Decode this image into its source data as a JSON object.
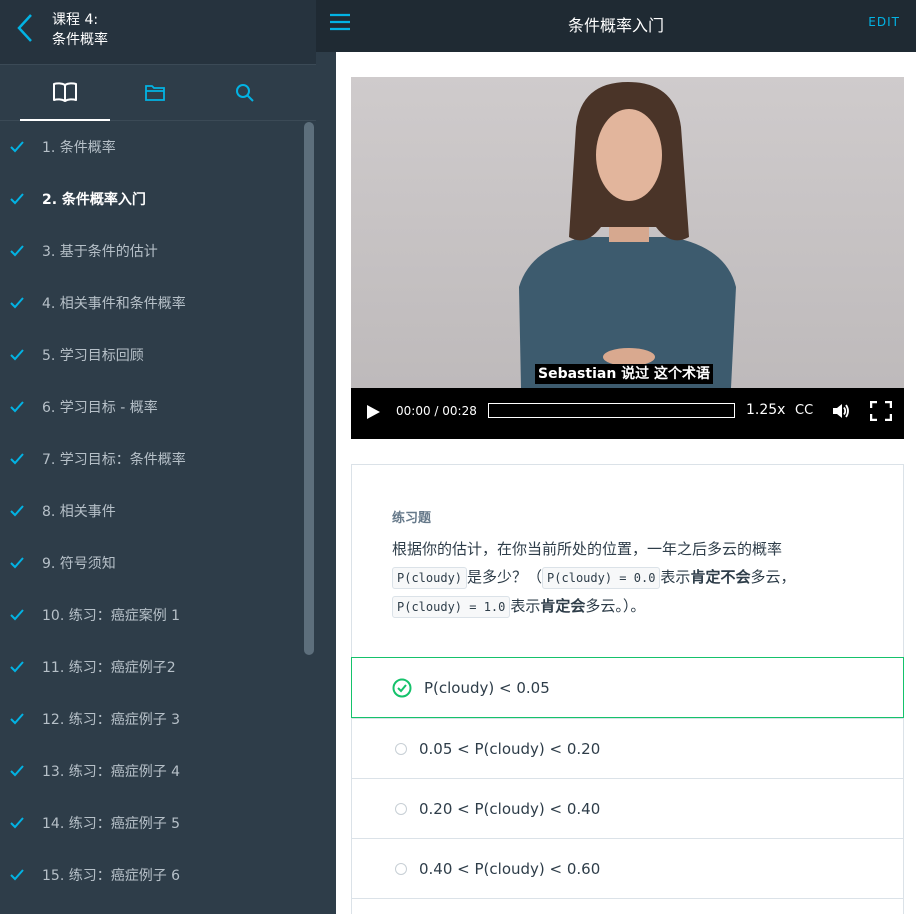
{
  "sidebar": {
    "course_label": "课程 4:",
    "course_name": "条件概率",
    "tabs": [
      {
        "icon": "book-icon"
      },
      {
        "icon": "folder-icon"
      },
      {
        "icon": "search-icon"
      }
    ],
    "items": [
      {
        "label": "1. 条件概率",
        "done": true
      },
      {
        "label": "2. 条件概率入门",
        "done": true,
        "active": true
      },
      {
        "label": "3. 基于条件的估计",
        "done": true
      },
      {
        "label": "4. 相关事件和条件概率",
        "done": true
      },
      {
        "label": "5. 学习目标回顾",
        "done": true
      },
      {
        "label": "6. 学习目标 - 概率",
        "done": true
      },
      {
        "label": "7. 学习目标：条件概率",
        "done": true
      },
      {
        "label": "8. 相关事件",
        "done": true
      },
      {
        "label": "9. 符号须知",
        "done": true
      },
      {
        "label": "10. 练习：癌症案例 1",
        "done": true
      },
      {
        "label": "11. 练习：癌症例子2",
        "done": true
      },
      {
        "label": "12. 练习：癌症例子 3",
        "done": true
      },
      {
        "label": "13. 练习：癌症例子 4",
        "done": true
      },
      {
        "label": "14. 练习：癌症例子 5",
        "done": true
      },
      {
        "label": "15. 练习：癌症例子 6",
        "done": true
      }
    ]
  },
  "header": {
    "title": "条件概率入门",
    "edit_label": "EDIT"
  },
  "video": {
    "caption": "Sebastian 说过 这个术语",
    "time": "00:00 / 00:28",
    "speed": "1.25x",
    "cc_label": "CC",
    "progress": 0
  },
  "quiz": {
    "label": "练习题",
    "q_part1": "根据你的估计，在你当前所处的位置，一年之后多云的概率",
    "code1": "P(cloudy)",
    "q_part2": "是多少？（",
    "code2": "P(cloudy) = 0.0",
    "q_part3": "表示",
    "q_bold1": "肯定不会",
    "q_part4": "多云，",
    "code3": "P(cloudy) = 1.0",
    "q_part5": "表示",
    "q_bold2": "肯定会",
    "q_part6": "多云。）。",
    "options": [
      {
        "text": "P(cloudy) < 0.05",
        "selected": true
      },
      {
        "text": "0.05 < P(cloudy) < 0.20",
        "selected": false
      },
      {
        "text": "0.20 < P(cloudy) < 0.40",
        "selected": false
      },
      {
        "text": "0.40 < P(cloudy) < 0.60",
        "selected": false
      }
    ]
  },
  "colors": {
    "sidebar_bg": "#2e3d49",
    "accent_cyan": "#02b3e4",
    "check_green": "#15c26b"
  }
}
